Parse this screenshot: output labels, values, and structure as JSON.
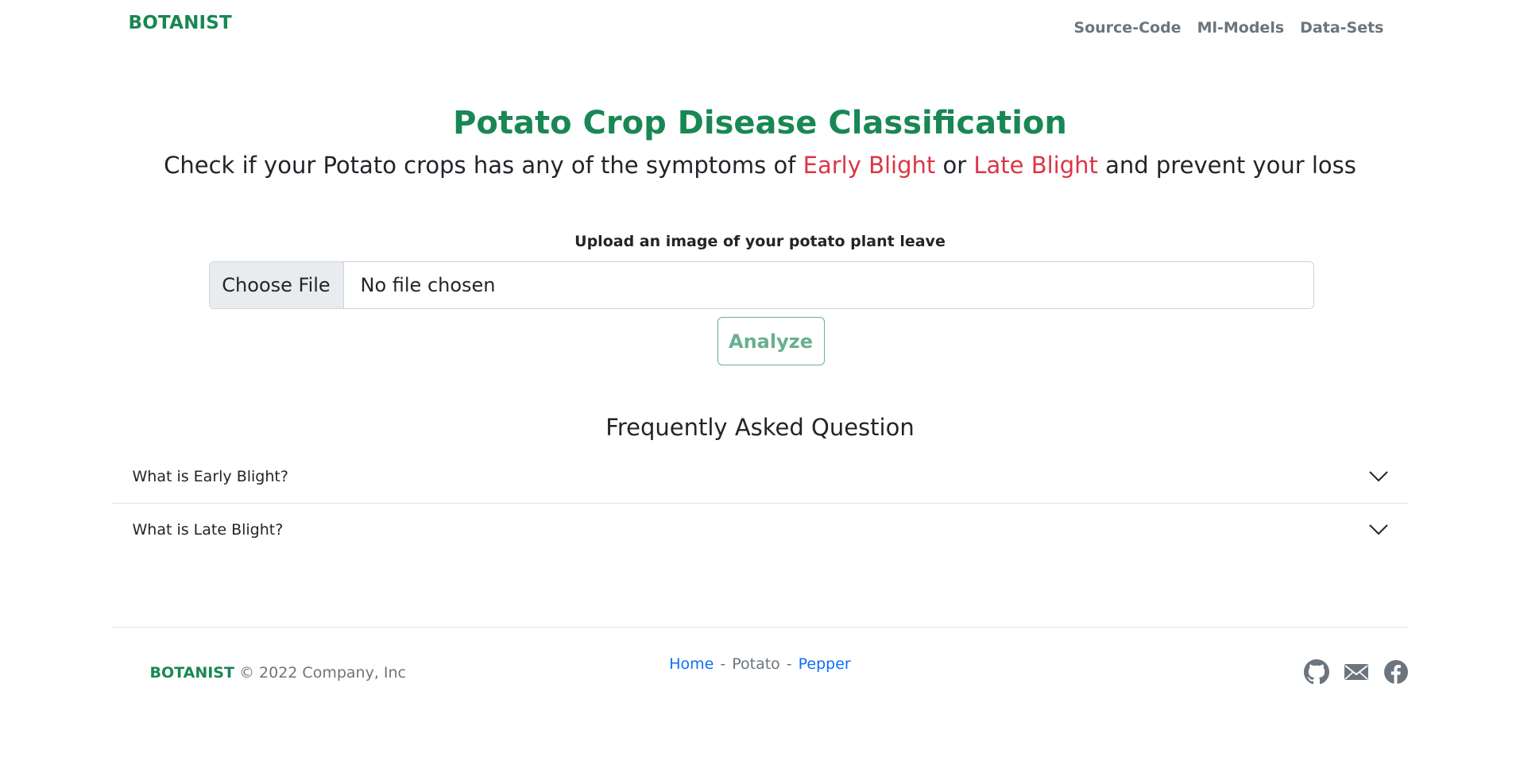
{
  "header": {
    "brand": "BOTANIST",
    "nav": [
      "Source-Code",
      "Ml-Models",
      "Data-Sets"
    ]
  },
  "hero": {
    "title": "Potato Crop Disease Classification",
    "subtitle_pre": "Check if your Potato crops has any of the symptoms of ",
    "early_blight": "Early Blight",
    "or": " or ",
    "late_blight": "Late Blight",
    "subtitle_post": " and prevent your loss"
  },
  "upload": {
    "label": "Upload an image of your potato plant leave",
    "choose_button": "Choose File",
    "status": "No file chosen",
    "analyze_button": "Analyze"
  },
  "faq": {
    "title": "Frequently Asked Question",
    "items": [
      "What is Early Blight?",
      "What is Late Blight?"
    ]
  },
  "footer": {
    "brand": "BOTANIST",
    "copyright": " © 2022 Company, Inc",
    "links": {
      "home": "Home",
      "sep": "-",
      "potato": "Potato",
      "pepper": "Pepper"
    },
    "icons": [
      "github-icon",
      "mail-icon",
      "facebook-icon"
    ]
  },
  "colors": {
    "primary": "#198754",
    "danger": "#dc3545",
    "link": "#0d6efd",
    "muted": "#6c757d"
  }
}
